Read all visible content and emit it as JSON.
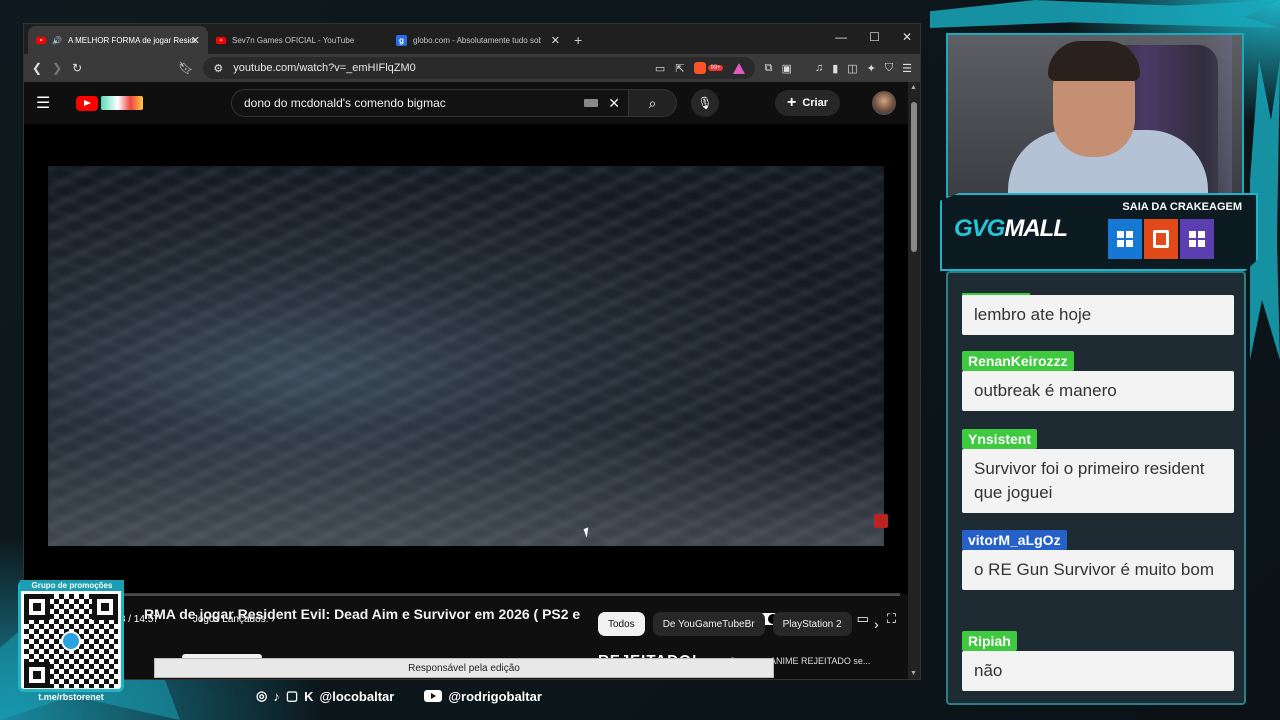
{
  "browser": {
    "tabs": [
      {
        "label": "A MELHOR FORMA de jogar Reside",
        "icon": "youtube-icon",
        "active": true
      },
      {
        "label": "Sev7n Games OFICIAL - YouTube",
        "icon": "youtube-icon",
        "active": false
      },
      {
        "label": "globo.com - Absolutamente tudo sobre notí",
        "icon": "globo-icon",
        "active": false
      }
    ],
    "new_tab": "+",
    "url": "youtube.com/watch?v=_emHIFlqZM0",
    "ext_badge": "99+"
  },
  "youtube": {
    "search_query": "dono do mcdonald's comendo bigmac",
    "create_label": "Criar",
    "player": {
      "time": "1:03 / 14:57",
      "progress_fraction": 0.071,
      "buffer_fraction": 0.09,
      "chapter": "Jogos Lançados."
    },
    "video_title": "RMA de jogar Resident Evil: Dead Aim e Survivor em 2026 ( PS2 e",
    "chips": [
      "Todos",
      "De YouGameTubeBr",
      "PlayStation 2"
    ],
    "recommended_title": "REJEITADO!",
    "recommended_sub": "Como um ANIME REJEITADO se...",
    "tooltip": "Responsável pela edição"
  },
  "overlay": {
    "banner_slogan": "SAIA DA CRAKEAGEM",
    "banner_brand_a": "GVG",
    "banner_brand_b": "MALL",
    "qr_label": "Grupo de promoções",
    "qr_url": "t.me/rbstorenet",
    "social_handle_1": "@locobaltar",
    "social_handle_2": "@rodrigobaltar"
  },
  "chat": [
    {
      "user": "",
      "text": "lembro ate hoje",
      "color": "#3ec93e"
    },
    {
      "user": "RenanKeirozzz",
      "text": "outbreak é manero",
      "color": "#3ec93e"
    },
    {
      "user": "Ynsistent",
      "text": "Survivor foi o primeiro resident que joguei",
      "color": "#3ec93e"
    },
    {
      "user": "vitorM_aLgOz",
      "text": "o RE Gun Survivor é muito bom",
      "color": "#2661c9"
    },
    {
      "user": "Ripiah",
      "text": "não",
      "color": "#3ec93e"
    }
  ]
}
